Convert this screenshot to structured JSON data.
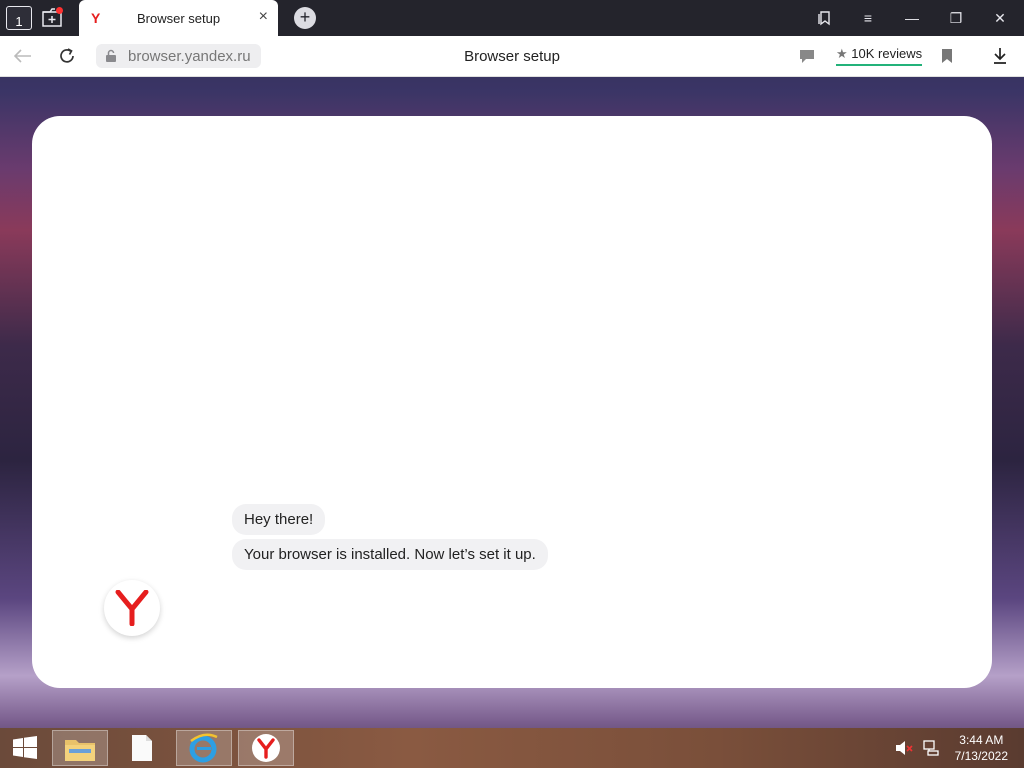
{
  "tabbar": {
    "home_count": "1",
    "tab_title": "Browser setup",
    "tab_close": "×",
    "tab_logo": "Y",
    "new_tab": "+"
  },
  "window_controls": {
    "minimize": "—",
    "restore": "❐",
    "close": "✕",
    "menu": "≡"
  },
  "addressbar": {
    "url": "browser.yandex.ru",
    "page_title": "Browser setup",
    "reviews_star": "★",
    "reviews_label": "10K reviews"
  },
  "chat": {
    "messages": [
      "Hey there!",
      "Your browser is installed. Now let’s set it up."
    ]
  },
  "taskbar": {
    "time": "3:44 AM",
    "date": "7/13/2022"
  },
  "colors": {
    "yandex_red": "#e61e1e",
    "reviews_underline": "#23b27a",
    "titlebar": "#24242c"
  }
}
